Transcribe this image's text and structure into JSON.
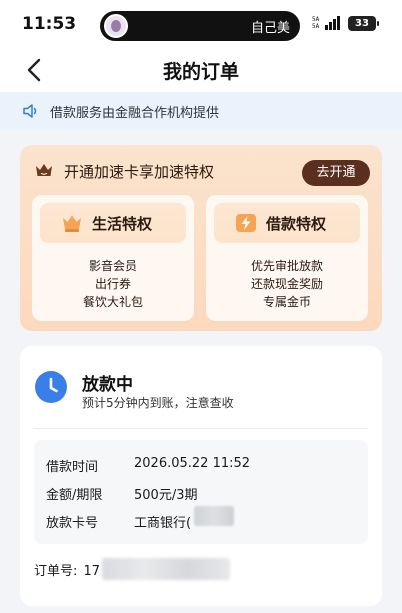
{
  "status_bar": {
    "time": "11:53",
    "contact_name": "自己美",
    "signal_label": "5A 5A",
    "battery": "33"
  },
  "nav": {
    "title": "我的订单",
    "back_icon": "chevron-left-icon"
  },
  "notice": {
    "icon": "speaker-icon",
    "text": "借款服务由金融合作机构提供"
  },
  "promo": {
    "title": "开通加速卡享加速特权",
    "open_button": "去开通",
    "perks": [
      {
        "title": "生活特权",
        "icon": "crown-cup-icon",
        "items": [
          "影音会员",
          "出行券",
          "餐饮大礼包"
        ]
      },
      {
        "title": "借款特权",
        "icon": "lightning-icon",
        "items": [
          "优先审批放款",
          "还款现金奖励",
          "专属金币"
        ]
      }
    ],
    "colors": {
      "button_bg": "#5b2f1f",
      "card_bg": "#fbe3cd"
    }
  },
  "order": {
    "status": "放款中",
    "subtitle": "预计5分钟内到账，注意查收",
    "details": [
      {
        "label": "借款时间",
        "value": "2026.05.22 11:52"
      },
      {
        "label": "金额/期限",
        "value": "500元/3期"
      },
      {
        "label": "放款卡号",
        "value": "工商银行("
      }
    ],
    "order_no_label": "订单号:",
    "order_no_visible": "17",
    "status_color": "#3a7ee8"
  }
}
